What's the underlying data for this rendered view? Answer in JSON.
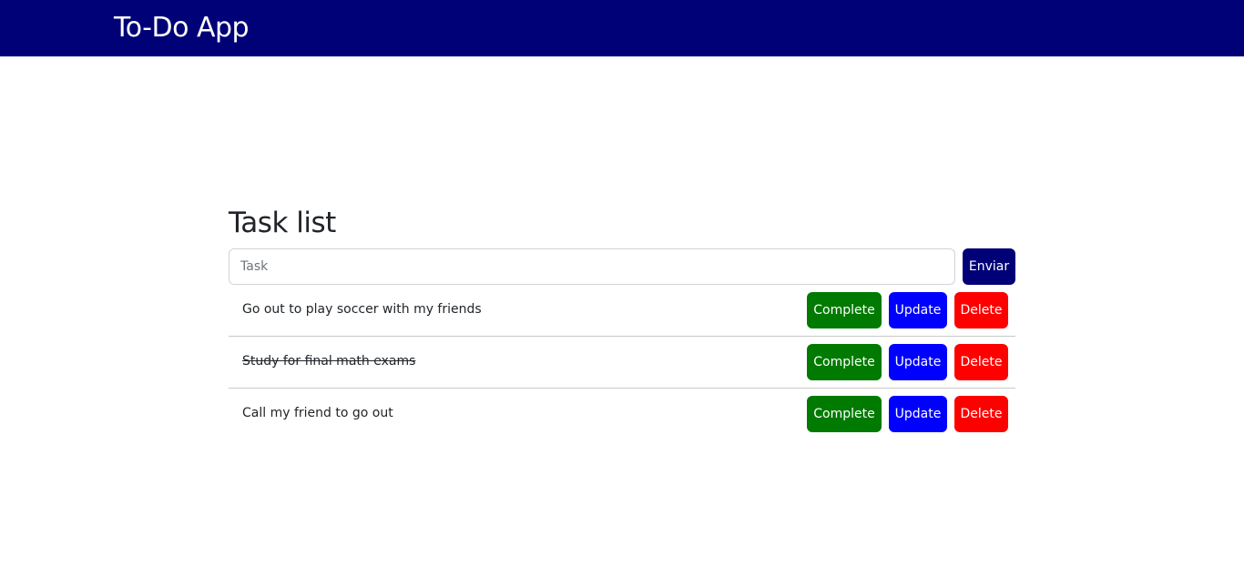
{
  "header": {
    "brand": "To-Do App"
  },
  "main": {
    "title": "Task list",
    "input_placeholder": "Task",
    "input_value": "",
    "submit_label": "Enviar",
    "tasks": [
      {
        "text": "Go out to play soccer with my friends",
        "completed": false
      },
      {
        "text": "Study for final math exams",
        "completed": true
      },
      {
        "text": "Call my friend to go out",
        "completed": false
      }
    ],
    "actions": {
      "complete_label": "Complete",
      "update_label": "Update",
      "delete_label": "Delete"
    }
  },
  "colors": {
    "navbar": "#000077",
    "complete": "#007a00",
    "update": "#0000ff",
    "delete": "#ff0000"
  }
}
